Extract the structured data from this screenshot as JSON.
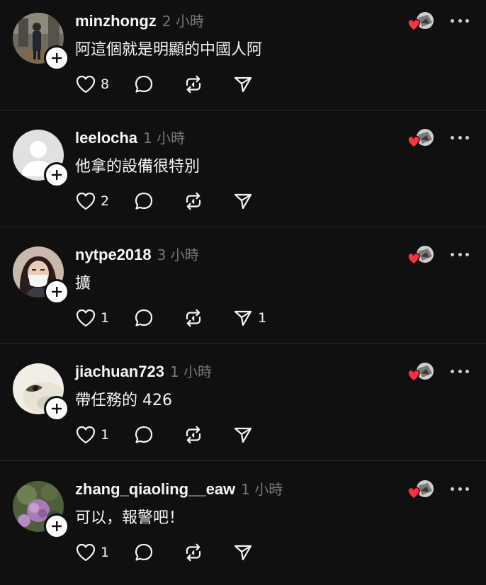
{
  "comments": [
    {
      "username": "minzhongz",
      "timestamp": "2 小時",
      "text": "阿這個就是明顯的中國人阿",
      "likes": "8",
      "replies": "",
      "reposts": "",
      "shares": "",
      "avatar": "photo-person-standing"
    },
    {
      "username": "leelocha",
      "timestamp": "1 小時",
      "text": "他拿的設備很特別",
      "likes": "2",
      "replies": "",
      "reposts": "",
      "shares": "",
      "avatar": "default-avatar"
    },
    {
      "username": "nytpe2018",
      "timestamp": "3 小時",
      "text": "擴",
      "likes": "1",
      "replies": "",
      "reposts": "",
      "shares": "1",
      "avatar": "photo-woman-mask"
    },
    {
      "username": "jiachuan723",
      "timestamp": "1 小時",
      "text": "帶任務的 426",
      "likes": "1",
      "replies": "",
      "reposts": "",
      "shares": "",
      "avatar": "photo-eye-closeup"
    },
    {
      "username": "zhang_qiaoling__eaw",
      "timestamp": "1 小時",
      "text": "可以，報警吧！",
      "likes": "1",
      "replies": "",
      "reposts": "",
      "shares": "",
      "avatar": "photo-flowers"
    }
  ],
  "icons": {
    "like": "heart-outline-icon",
    "reply": "comment-bubble-icon",
    "repost": "repost-arrows-icon",
    "share": "send-paper-plane-icon",
    "follow": "plus-icon",
    "liked_by_author": "red-heart-badge-icon",
    "more": "more-dots-icon"
  },
  "colors": {
    "background": "#101010",
    "text": "#f3f5f7",
    "secondary": "#777777",
    "divider": "#2a2a2a",
    "heart": "#ff3040"
  }
}
